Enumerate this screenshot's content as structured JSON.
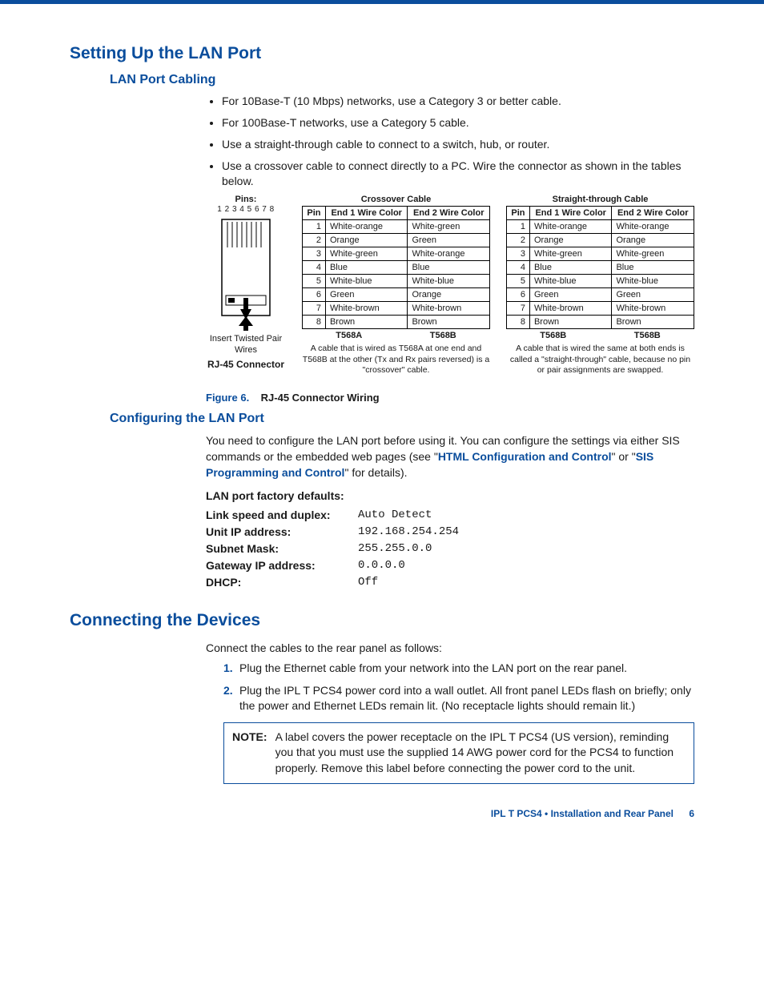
{
  "h1_lan": "Setting Up the LAN Port",
  "h2_cabling": "LAN Port Cabling",
  "bullets": [
    "For 10Base-T (10 Mbps) networks, use a Category 3 or better cable.",
    "For 100Base-T networks, use a Category 5 cable.",
    "Use a straight-through cable to connect to a switch, hub, or router.",
    "Use a crossover cable to connect directly to a PC. Wire the connector as shown in the tables below."
  ],
  "rj45": {
    "pins_label": "Pins:",
    "pins_numbers": "1 2 3 4 5 6 7 8",
    "insert_text": "Insert Twisted Pair Wires",
    "name": "RJ-45 Connector"
  },
  "table_headers": {
    "pin": "Pin",
    "end1": "End 1 Wire Color",
    "end2": "End 2 Wire Color"
  },
  "crossover": {
    "title": "Crossover Cable",
    "rows": [
      {
        "pin": "1",
        "e1": "White-orange",
        "e2": "White-green"
      },
      {
        "pin": "2",
        "e1": "Orange",
        "e2": "Green"
      },
      {
        "pin": "3",
        "e1": "White-green",
        "e2": "White-orange"
      },
      {
        "pin": "4",
        "e1": "Blue",
        "e2": "Blue"
      },
      {
        "pin": "5",
        "e1": "White-blue",
        "e2": "White-blue"
      },
      {
        "pin": "6",
        "e1": "Green",
        "e2": "Orange"
      },
      {
        "pin": "7",
        "e1": "White-brown",
        "e2": "White-brown"
      },
      {
        "pin": "8",
        "e1": "Brown",
        "e2": "Brown"
      }
    ],
    "foot1": "T568A",
    "foot2": "T568B",
    "caption": "A cable that is wired as T568A at one end and T568B at the other (Tx and Rx pairs reversed) is a \"crossover\" cable."
  },
  "straight": {
    "title": "Straight-through Cable",
    "rows": [
      {
        "pin": "1",
        "e1": "White-orange",
        "e2": "White-orange"
      },
      {
        "pin": "2",
        "e1": "Orange",
        "e2": "Orange"
      },
      {
        "pin": "3",
        "e1": "White-green",
        "e2": "White-green"
      },
      {
        "pin": "4",
        "e1": "Blue",
        "e2": "Blue"
      },
      {
        "pin": "5",
        "e1": "White-blue",
        "e2": "White-blue"
      },
      {
        "pin": "6",
        "e1": "Green",
        "e2": "Green"
      },
      {
        "pin": "7",
        "e1": "White-brown",
        "e2": "White-brown"
      },
      {
        "pin": "8",
        "e1": "Brown",
        "e2": "Brown"
      }
    ],
    "foot1": "T568B",
    "foot2": "T568B",
    "caption": "A cable that is wired the same at both ends is called a \"straight-through\" cable, because no pin or pair assignments are swapped."
  },
  "figure": {
    "label": "Figure 6.",
    "text": "RJ-45 Connector Wiring"
  },
  "h2_config": "Configuring the LAN Port",
  "config_text_1": "You need to configure the LAN port before using it. You can configure the settings via either SIS commands or the embedded web pages (see \"",
  "link1": "HTML Configuration and Control",
  "config_text_2": "\" or \"",
  "link2": "SIS Programming and Control",
  "config_text_3": "\" for details).",
  "defaults_title": "LAN port factory defaults:",
  "defaults": [
    {
      "k": "Link speed and duplex:",
      "v": "Auto Detect"
    },
    {
      "k": "Unit IP address:",
      "v": "192.168.254.254"
    },
    {
      "k": "Subnet Mask:",
      "v": "255.255.0.0"
    },
    {
      "k": "Gateway IP address:",
      "v": "0.0.0.0"
    },
    {
      "k": "DHCP:",
      "v": "Off"
    }
  ],
  "h1_connect": "Connecting the Devices",
  "connect_intro": "Connect the cables to the rear panel as follows:",
  "steps": [
    "Plug the Ethernet cable from your network into the LAN port on the rear panel.",
    "Plug the IPL T PCS4 power cord into a wall outlet. All front panel LEDs flash on briefly; only the power and Ethernet LEDs remain lit. (No receptacle lights should remain lit.)"
  ],
  "note": {
    "label": "NOTE:",
    "text": "A label covers the power receptacle on the IPL T PCS4 (US version), reminding you that you must use the supplied 14 AWG power cord for the PCS4 to function properly. Remove this label before connecting the power cord to the unit."
  },
  "footer": {
    "text": "IPL T PCS4 • Installation and Rear Panel",
    "page": "6"
  }
}
